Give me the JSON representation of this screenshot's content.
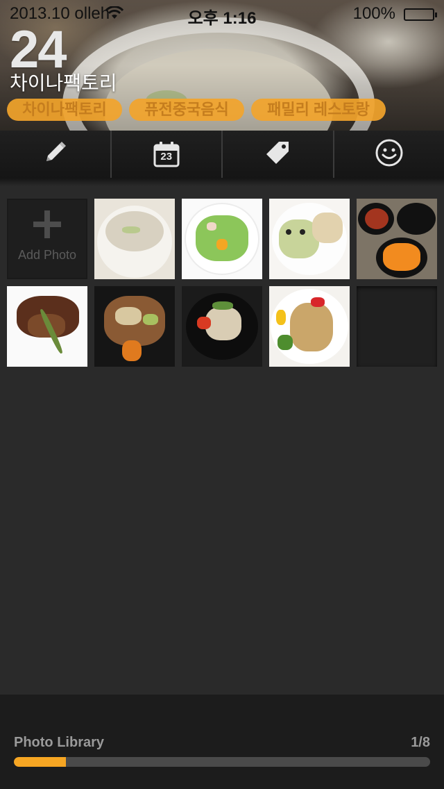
{
  "status_bar": {
    "carrier": "2013.10 olleh",
    "time": "오후 1:16",
    "battery": "100%"
  },
  "header": {
    "day": "24",
    "title": "차이나팩토리",
    "tags": [
      "차이나팩토리",
      "퓨전중국음식",
      "패밀리 레스토랑"
    ]
  },
  "toolbar": {
    "calendar_day": "23",
    "icons": [
      "pencil-icon",
      "calendar-icon",
      "tag-icon",
      "smiley-icon"
    ]
  },
  "grid": {
    "add_photo_label": "Add Photo"
  },
  "photo_library": {
    "label": "Photo Library",
    "count": "1/8",
    "progress": 0.125
  },
  "colors": {
    "accent": "#f6a623",
    "tag_bg": "#f2a42b",
    "tag_text": "#c57d1e",
    "background": "#2a2a2a"
  }
}
